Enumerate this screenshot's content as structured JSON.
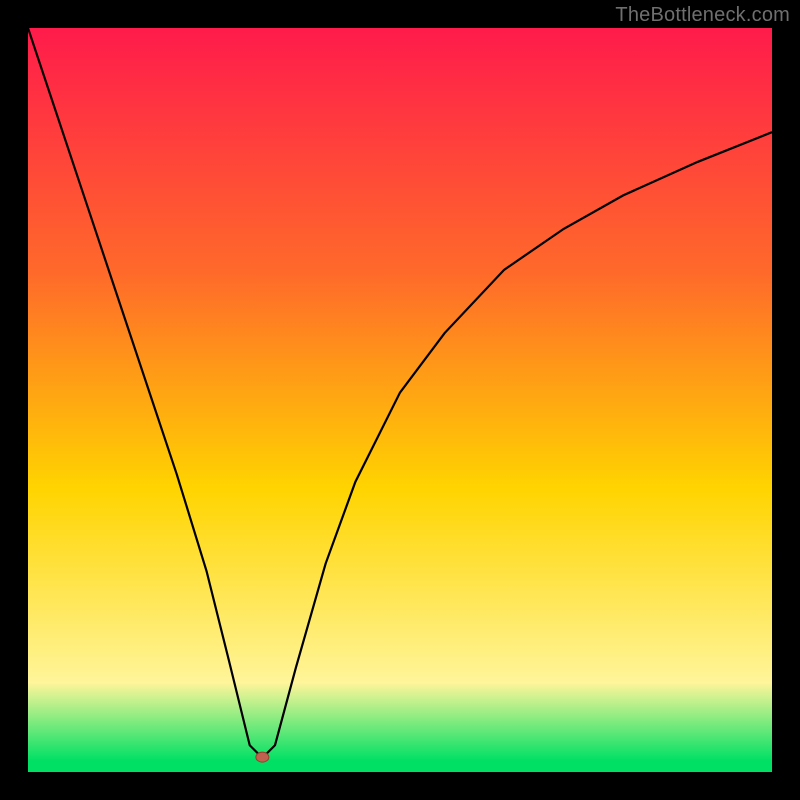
{
  "watermark": "TheBottleneck.com",
  "colors": {
    "frame": "#000000",
    "grad_top": "#ff1b4b",
    "grad_mid1": "#ff6a2a",
    "grad_mid2": "#ffd400",
    "grad_mid3": "#fff59a",
    "grad_green": "#00e064",
    "curve": "#000000",
    "marker_fill": "#c0604e",
    "marker_stroke": "#9a3e2e"
  },
  "chart_data": {
    "type": "line",
    "title": "",
    "xlabel": "",
    "ylabel": "",
    "xlim": [
      0,
      100
    ],
    "ylim": [
      0,
      100
    ],
    "curve": {
      "x": [
        0,
        4,
        8,
        12,
        16,
        20,
        24,
        27,
        29.8,
        31.4,
        31.6,
        33.2,
        36,
        40,
        44,
        50,
        56,
        64,
        72,
        80,
        90,
        100
      ],
      "y": [
        100,
        88,
        76,
        64,
        52,
        40,
        27,
        15,
        3.6,
        2.0,
        2.0,
        3.6,
        14,
        28,
        39,
        51,
        59,
        67.5,
        73,
        77.5,
        82,
        86
      ]
    },
    "min_marker": {
      "x": 31.5,
      "y": 2.0
    },
    "clamp_band_y": 2.0
  }
}
